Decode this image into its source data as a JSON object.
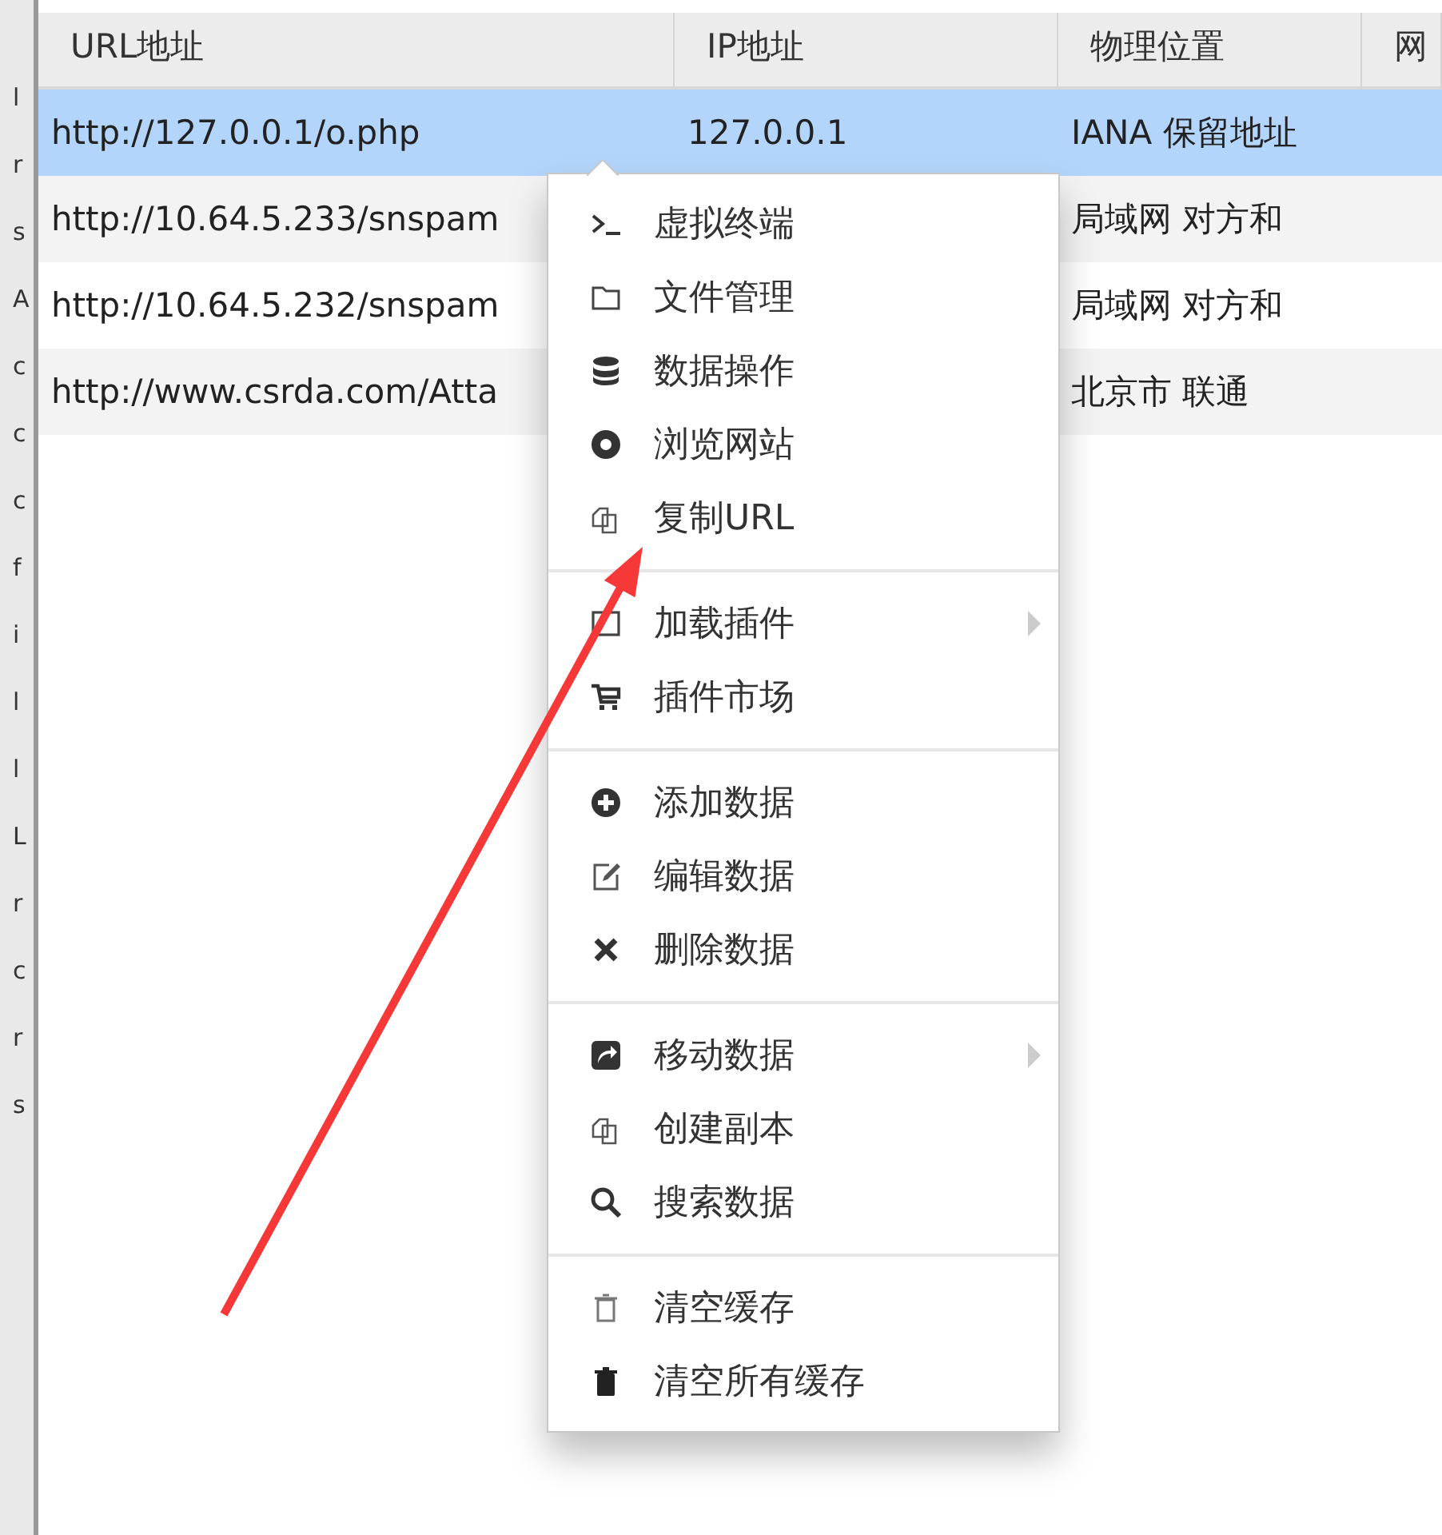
{
  "side_letters": [
    "l",
    "r",
    "s",
    "A",
    "c",
    "c",
    "c",
    "f",
    "i",
    "l",
    "l",
    "L",
    "r",
    "c",
    "r",
    "s"
  ],
  "table": {
    "columns": [
      "URL地址",
      "IP地址",
      "物理位置",
      "网"
    ],
    "rows": [
      {
        "selected": true,
        "cells": [
          "http://127.0.0.1/o.php",
          "127.0.0.1",
          "IANA 保留地址"
        ]
      },
      {
        "selected": false,
        "cells": [
          "http://10.64.5.233/snspam",
          "",
          "局域网 对方和"
        ]
      },
      {
        "selected": false,
        "cells": [
          "http://10.64.5.232/snspam",
          "",
          "局域网 对方和"
        ]
      },
      {
        "selected": false,
        "cells": [
          "http://www.csrda.com/Atta",
          "",
          "北京市 联通"
        ]
      }
    ]
  },
  "context_menu": {
    "sections": [
      {
        "items": [
          {
            "label": "虚拟终端",
            "submenu": false
          },
          {
            "label": "文件管理",
            "submenu": false
          },
          {
            "label": "数据操作",
            "submenu": false
          },
          {
            "label": "浏览网站",
            "submenu": false
          },
          {
            "label": "复制URL",
            "submenu": false
          }
        ]
      },
      {
        "items": [
          {
            "label": "加载插件",
            "submenu": true
          },
          {
            "label": "插件市场",
            "submenu": false
          }
        ]
      },
      {
        "items": [
          {
            "label": "添加数据",
            "submenu": false
          },
          {
            "label": "编辑数据",
            "submenu": false
          },
          {
            "label": "删除数据",
            "submenu": false
          }
        ]
      },
      {
        "items": [
          {
            "label": "移动数据",
            "submenu": true
          },
          {
            "label": "创建副本",
            "submenu": false
          },
          {
            "label": "搜索数据",
            "submenu": false
          }
        ]
      },
      {
        "items": [
          {
            "label": "清空缓存",
            "submenu": false
          },
          {
            "label": "清空所有缓存",
            "submenu": false
          }
        ]
      }
    ]
  }
}
